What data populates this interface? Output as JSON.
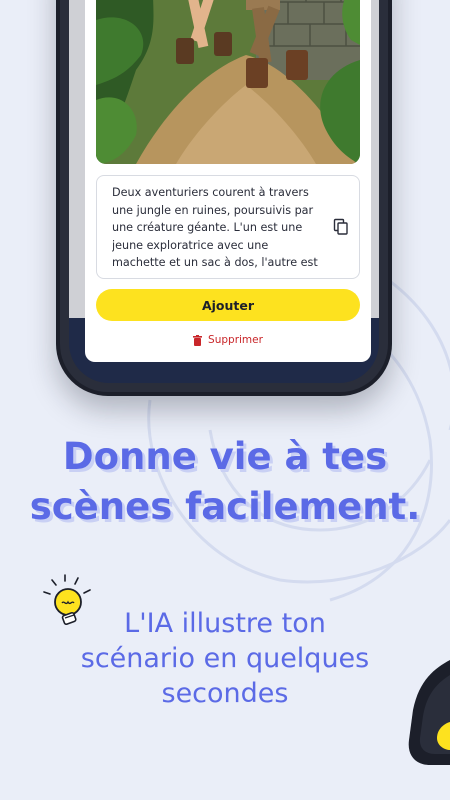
{
  "phone_screen": {
    "description_text": "Deux aventuriers courent à travers une jungle en ruines, poursuivis par une créature géante. L'un est une jeune exploratrice avec une machette et un sac à dos, l'autre est un pilote",
    "add_button_label": "Ajouter",
    "delete_label": "Supprimer",
    "illustration_icon": "jungle-adventure-illustration",
    "copy_icon": "copy-icon",
    "trash_icon": "trash-icon"
  },
  "headline": {
    "line1": "Donne vie à tes",
    "line2": "scènes facilement."
  },
  "subline": {
    "line1": "L'IA illustre ton",
    "line2": "scénario en quelques",
    "line3": "secondes"
  },
  "colors": {
    "background": "#eaeef8",
    "accent_blue": "#5b6ae6",
    "button_yellow": "#fde21f",
    "delete_red": "#c9262a"
  }
}
